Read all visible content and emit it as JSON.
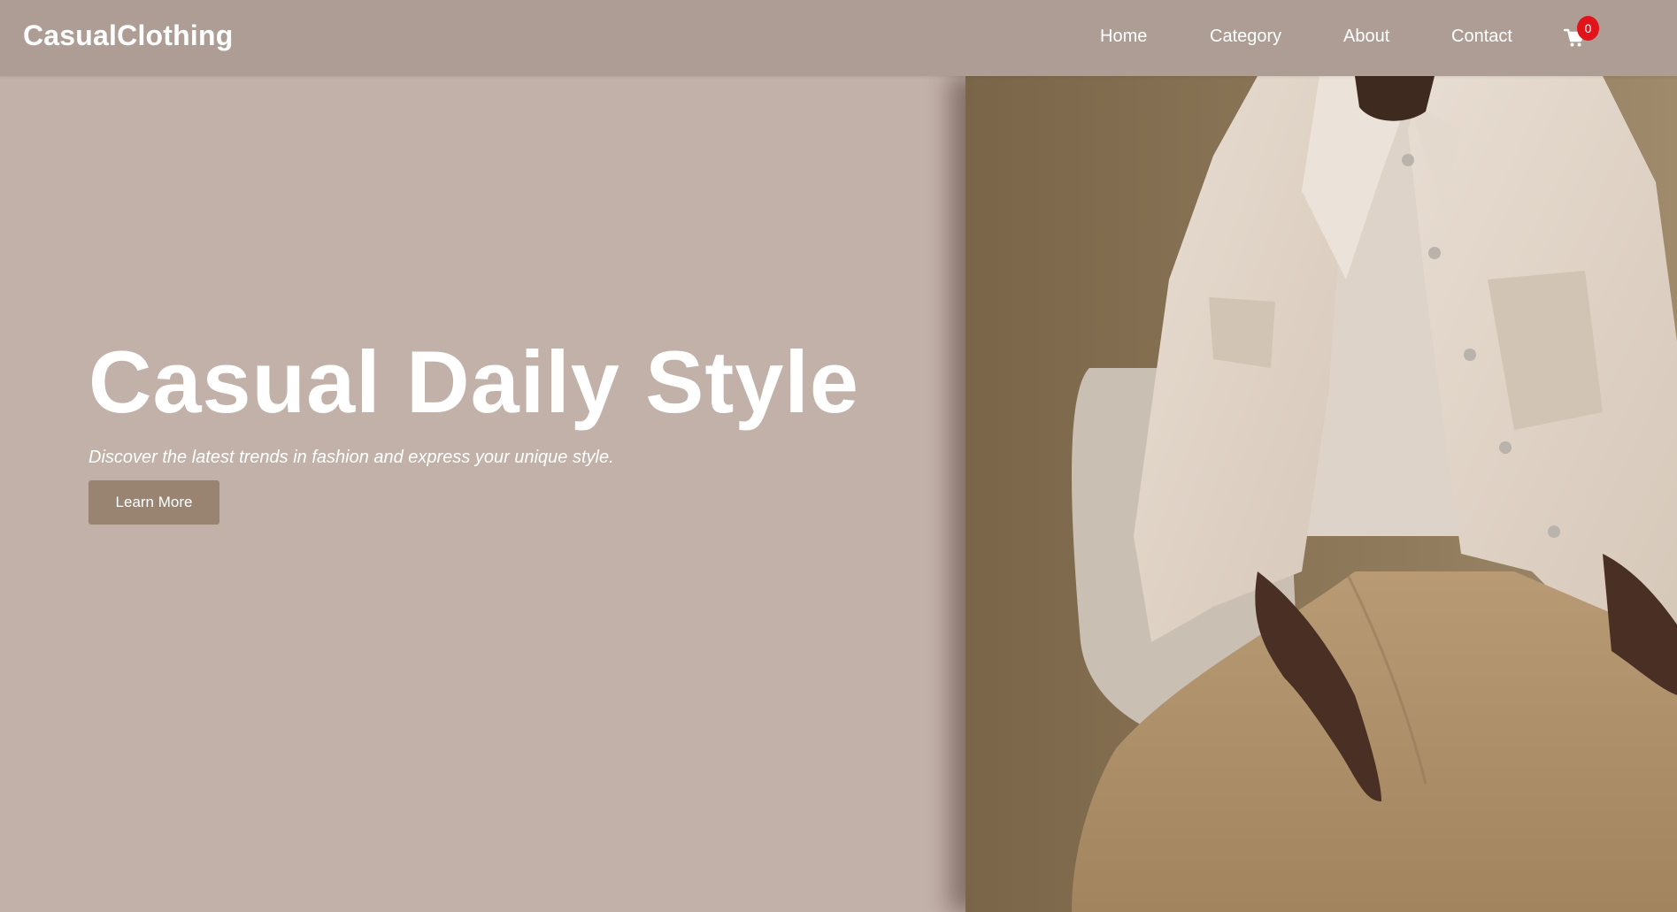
{
  "header": {
    "brand": "CasualClothing",
    "nav": [
      {
        "label": "Home"
      },
      {
        "label": "Category"
      },
      {
        "label": "About"
      },
      {
        "label": "Contact"
      }
    ],
    "cart": {
      "icon": "shopping-cart-icon",
      "count": "0"
    }
  },
  "hero": {
    "title": "Casual Daily Style",
    "subtitle": "Discover the latest trends in fashion and express your unique style.",
    "button_label": "Learn More",
    "image": "model-seated-photo"
  },
  "colors": {
    "navbar": "#ad9d95",
    "hero_background": "#c2b1a8",
    "button": "#988470",
    "badge": "#e0141a",
    "text": "#ffffff"
  }
}
